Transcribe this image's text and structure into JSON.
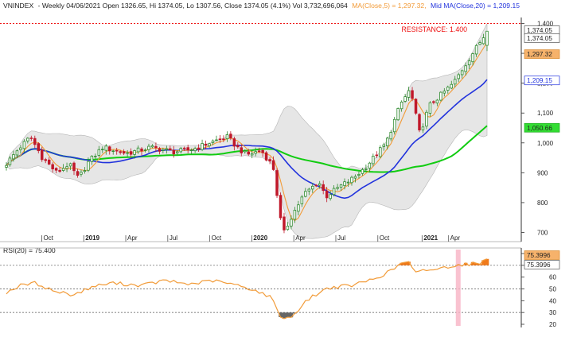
{
  "header": {
    "symbol": "VNINDEX",
    "summary": "- Weekly 04/06/2021 Open 1326.65, Hi 1374.05, Lo 1307.56, Close 1374.05 (4.1%) Vol 3,732,696,064",
    "ma5_text": "MA(Close,5) = 1,297.32,",
    "ma20_text": "Mid MA(Close,20) = 1,209.15"
  },
  "resistance_label": "RESISTANCE: 1.400",
  "rsi_header": "RSI(20) = 75.400",
  "colors": {
    "up": "#2e8b2e",
    "down": "#c0182a",
    "ma5": "#f29b38",
    "ma20": "#2233dd",
    "ma50": "#11cc11",
    "band": "#d2d2d2",
    "resistance": "#ee1111",
    "rsi": "#f29b38",
    "rsi_low_fill": "#666666",
    "highlight": "#f7b3c4"
  },
  "chart_data": [
    {
      "type": "candlestick",
      "title": "VNINDEX - Weekly",
      "period": [
        "2018-08",
        "2021-04"
      ],
      "x_ticks": [
        "Oct",
        "2019",
        "Apr",
        "Jul",
        "Oct",
        "2020",
        "Apr",
        "Jul",
        "Oct",
        "2021",
        "Apr"
      ],
      "ylim": [
        680,
        1420
      ],
      "y_ticks": [
        700,
        800,
        900,
        1000,
        1100,
        1200,
        1300,
        1400
      ],
      "y_tick_labels": [
        "700",
        "800",
        "900",
        "1,000",
        "1,100",
        "1,200",
        "1,300",
        "1,400"
      ],
      "last_candle": {
        "open": 1326.65,
        "high": 1374.05,
        "low": 1307.56,
        "close": 1374.05
      },
      "close_anchors": [
        {
          "t": 0.0,
          "v": 930
        },
        {
          "t": 0.025,
          "v": 980
        },
        {
          "t": 0.05,
          "v": 1020
        },
        {
          "t": 0.075,
          "v": 950
        },
        {
          "t": 0.105,
          "v": 900
        },
        {
          "t": 0.13,
          "v": 930
        },
        {
          "t": 0.15,
          "v": 880
        },
        {
          "t": 0.17,
          "v": 935
        },
        {
          "t": 0.2,
          "v": 985
        },
        {
          "t": 0.25,
          "v": 965
        },
        {
          "t": 0.3,
          "v": 985
        },
        {
          "t": 0.35,
          "v": 970
        },
        {
          "t": 0.39,
          "v": 980
        },
        {
          "t": 0.43,
          "v": 1005
        },
        {
          "t": 0.46,
          "v": 1020
        },
        {
          "t": 0.48,
          "v": 985
        },
        {
          "t": 0.5,
          "v": 960
        },
        {
          "t": 0.53,
          "v": 975
        },
        {
          "t": 0.555,
          "v": 920
        },
        {
          "t": 0.575,
          "v": 690
        },
        {
          "t": 0.595,
          "v": 760
        },
        {
          "t": 0.62,
          "v": 830
        },
        {
          "t": 0.65,
          "v": 870
        },
        {
          "t": 0.665,
          "v": 820
        },
        {
          "t": 0.69,
          "v": 850
        },
        {
          "t": 0.72,
          "v": 880
        },
        {
          "t": 0.745,
          "v": 915
        },
        {
          "t": 0.79,
          "v": 1000
        },
        {
          "t": 0.82,
          "v": 1130
        },
        {
          "t": 0.84,
          "v": 1180
        },
        {
          "t": 0.86,
          "v": 1030
        },
        {
          "t": 0.88,
          "v": 1125
        },
        {
          "t": 0.9,
          "v": 1155
        },
        {
          "t": 0.93,
          "v": 1200
        },
        {
          "t": 0.95,
          "v": 1250
        },
        {
          "t": 0.97,
          "v": 1300
        },
        {
          "t": 1.0,
          "v": 1374.05
        }
      ],
      "resistance": 1400,
      "legend": [
        {
          "name": "Close",
          "value": "1,374.05"
        },
        {
          "name": "MA(Close,5)",
          "value": "1,297.32"
        },
        {
          "name": "Mid MA(Close,20)",
          "value": "1,209.15"
        }
      ],
      "axis_value_labels": [
        {
          "value": 1374.05,
          "text": "1,374.05",
          "style": "box"
        },
        {
          "value": 1374.05,
          "text": "1,374.05",
          "style": "box"
        },
        {
          "value": 1297.32,
          "text": "1,297.32",
          "style": "orange"
        },
        {
          "value": 1209.15,
          "text": "1,209.15",
          "style": "blue"
        },
        {
          "value": 1050.66,
          "text": "1,050.66",
          "style": "green"
        }
      ]
    },
    {
      "type": "line",
      "title": "RSI(20)",
      "ylim": [
        20,
        82
      ],
      "y_ticks": [
        20,
        30,
        40,
        50,
        60,
        70,
        80
      ],
      "reference_lines": [
        30,
        50,
        70
      ],
      "rsi_anchors": [
        {
          "t": 0.0,
          "v": 47
        },
        {
          "t": 0.03,
          "v": 53
        },
        {
          "t": 0.06,
          "v": 55
        },
        {
          "t": 0.1,
          "v": 48
        },
        {
          "t": 0.14,
          "v": 45
        },
        {
          "t": 0.18,
          "v": 52
        },
        {
          "t": 0.22,
          "v": 55
        },
        {
          "t": 0.28,
          "v": 53
        },
        {
          "t": 0.33,
          "v": 57
        },
        {
          "t": 0.38,
          "v": 54
        },
        {
          "t": 0.43,
          "v": 57
        },
        {
          "t": 0.47,
          "v": 54
        },
        {
          "t": 0.51,
          "v": 50
        },
        {
          "t": 0.55,
          "v": 43
        },
        {
          "t": 0.575,
          "v": 24
        },
        {
          "t": 0.595,
          "v": 27
        },
        {
          "t": 0.63,
          "v": 42
        },
        {
          "t": 0.67,
          "v": 51
        },
        {
          "t": 0.72,
          "v": 53
        },
        {
          "t": 0.76,
          "v": 58
        },
        {
          "t": 0.79,
          "v": 63
        },
        {
          "t": 0.82,
          "v": 71
        },
        {
          "t": 0.835,
          "v": 74
        },
        {
          "t": 0.85,
          "v": 63
        },
        {
          "t": 0.87,
          "v": 66
        },
        {
          "t": 0.9,
          "v": 67
        },
        {
          "t": 0.93,
          "v": 70
        },
        {
          "t": 0.96,
          "v": 71
        },
        {
          "t": 0.985,
          "v": 72
        },
        {
          "t": 1.0,
          "v": 75.4
        }
      ],
      "highlight_t": 0.94,
      "axis_value_labels": [
        {
          "value": 75.3996,
          "text": "75.3996",
          "style": "orange"
        },
        {
          "value": 75.3996,
          "text": "75.3996",
          "style": "dark"
        }
      ]
    }
  ]
}
